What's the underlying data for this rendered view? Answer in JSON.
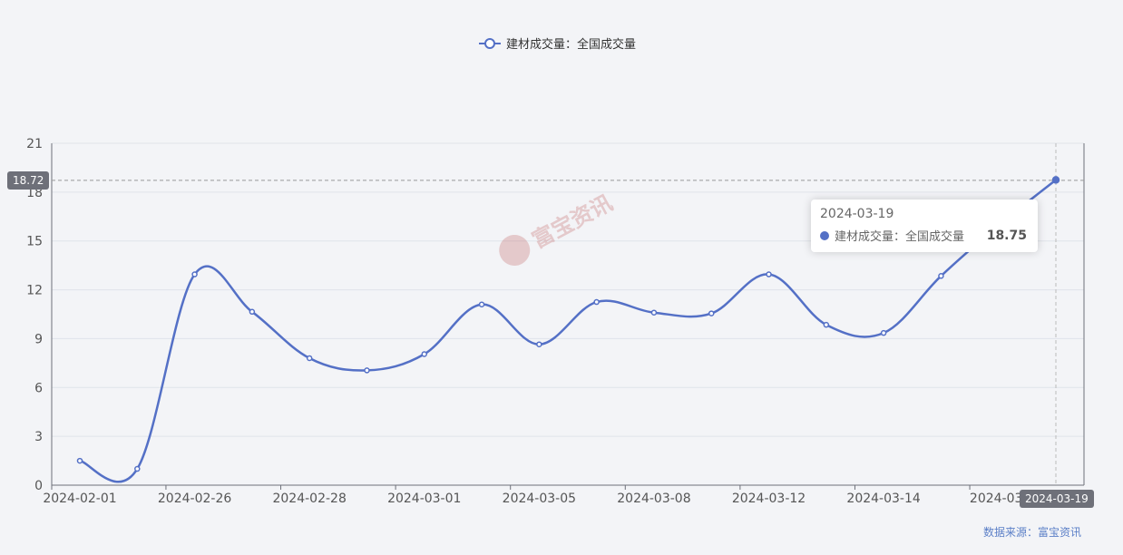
{
  "legend": {
    "label": "建材成交量：全国成交量",
    "color": "#5470c6"
  },
  "tooltip": {
    "date": "2024-03-19",
    "series_label": "建材成交量：全国成交量",
    "value": "18.75"
  },
  "crosshair": {
    "y_badge": "18.72",
    "x_badge": "2024-03-19"
  },
  "watermark": {
    "text": "富宝资讯"
  },
  "source": {
    "text": "数据来源：富宝资讯"
  },
  "chart_data": {
    "type": "line",
    "smooth": true,
    "categories": [
      "2024-02-01",
      "",
      "2024-02-26",
      "",
      "2024-02-28",
      "",
      "2024-03-01",
      "",
      "2024-03-05",
      "",
      "2024-03-08",
      "",
      "2024-03-12",
      "",
      "2024-03-14",
      "",
      "2024-03-",
      "2024-03-19"
    ],
    "series": [
      {
        "name": "建材成交量：全国成交量",
        "color": "#5470c6",
        "values": [
          1.5,
          1.0,
          12.95,
          10.65,
          7.8,
          7.05,
          8.05,
          11.1,
          8.65,
          11.25,
          10.6,
          10.55,
          12.95,
          9.85,
          9.35,
          12.85,
          15.95,
          18.75
        ]
      }
    ],
    "x_tick_labels": [
      "2024-02-01",
      "2024-02-26",
      "2024-02-28",
      "2024-03-01",
      "2024-03-05",
      "2024-03-08",
      "2024-03-12",
      "2024-03-14",
      "2024-03-"
    ],
    "y_ticks": [
      0,
      3,
      6,
      9,
      12,
      15,
      18,
      21
    ],
    "ylim": [
      0,
      21
    ],
    "crosshair_y": 18.72,
    "grid": true,
    "legend_position": "top-center"
  }
}
